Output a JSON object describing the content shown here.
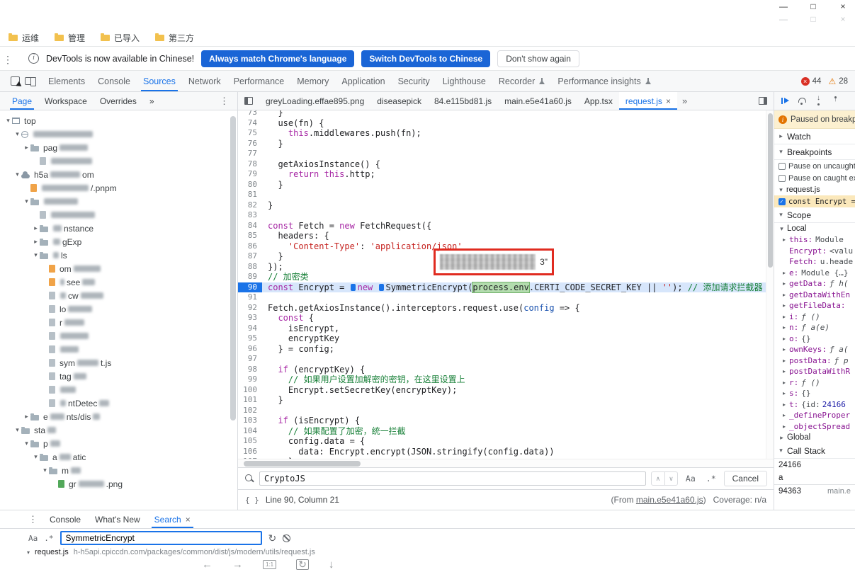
{
  "title_bar": {
    "controls": [
      "minimize",
      "maximize",
      "close"
    ]
  },
  "bookmarks": {
    "items": [
      "运维",
      "管理",
      "已导入",
      "第三方"
    ]
  },
  "banner": {
    "message": "DevTools is now available in Chinese!",
    "primary_buttons": [
      "Always match Chrome's language",
      "Switch DevTools to Chinese"
    ],
    "secondary_button": "Don't show again"
  },
  "toolbar": {
    "tabs": [
      "Elements",
      "Console",
      "Sources",
      "Network",
      "Performance",
      "Memory",
      "Application",
      "Security",
      "Lighthouse",
      "Recorder",
      "Performance insights"
    ],
    "selected_tab": "Sources",
    "flask_tabs": [
      "Recorder",
      "Performance insights"
    ],
    "error_count": "44",
    "warning_count": "28"
  },
  "navigator": {
    "tabs": [
      "Page",
      "Workspace",
      "Overrides",
      "»"
    ],
    "selected_tab": "Page",
    "tree": [
      {
        "lvl": 0,
        "arrow": "open",
        "icon": "frame",
        "parts": [
          {
            "t": "top"
          }
        ]
      },
      {
        "lvl": 1,
        "arrow": "open",
        "icon": "globe",
        "parts": [
          {
            "b": 84
          }
        ]
      },
      {
        "lvl": 2,
        "arrow": "closed",
        "icon": "folder",
        "parts": [
          {
            "t": "pag"
          },
          {
            "b": 40
          }
        ]
      },
      {
        "lvl": 3,
        "arrow": "none",
        "icon": "doc",
        "parts": [
          {
            "b": 58
          }
        ]
      },
      {
        "lvl": 1,
        "arrow": "open",
        "icon": "cloud",
        "parts": [
          {
            "t": "h5a"
          },
          {
            "b": 42
          },
          {
            "t": "om"
          }
        ]
      },
      {
        "lvl": 2,
        "arrow": "none",
        "icon": "doc-o",
        "parts": [
          {
            "b": 66
          },
          {
            "t": "/.pnpm"
          }
        ]
      },
      {
        "lvl": 2,
        "arrow": "open",
        "icon": "folder",
        "parts": [
          {
            "b": 48
          }
        ]
      },
      {
        "lvl": 3,
        "arrow": "none",
        "icon": "doc",
        "parts": [
          {
            "b": 62
          }
        ]
      },
      {
        "lvl": 3,
        "arrow": "closed",
        "icon": "folder",
        "parts": [
          {
            "b": 12
          },
          {
            "t": "nstance"
          }
        ]
      },
      {
        "lvl": 3,
        "arrow": "closed",
        "icon": "folder",
        "parts": [
          {
            "b": 10
          },
          {
            "t": "gExp"
          }
        ]
      },
      {
        "lvl": 3,
        "arrow": "open",
        "icon": "folder",
        "parts": [
          {
            "b": 8
          },
          {
            "t": "ls"
          }
        ]
      },
      {
        "lvl": 4,
        "arrow": "none",
        "icon": "doc-o",
        "parts": [
          {
            "t": "om"
          },
          {
            "b": 38
          }
        ]
      },
      {
        "lvl": 4,
        "arrow": "none",
        "icon": "doc-o",
        "parts": [
          {
            "b": 6
          },
          {
            "t": "see"
          },
          {
            "b": 18
          }
        ]
      },
      {
        "lvl": 4,
        "arrow": "none",
        "icon": "doc",
        "parts": [
          {
            "b": 8
          },
          {
            "t": "cw"
          },
          {
            "b": 32
          }
        ]
      },
      {
        "lvl": 4,
        "arrow": "none",
        "icon": "doc",
        "parts": [
          {
            "t": "lo"
          },
          {
            "b": 34
          }
        ]
      },
      {
        "lvl": 4,
        "arrow": "none",
        "icon": "doc",
        "parts": [
          {
            "t": "r"
          },
          {
            "b": 28
          }
        ]
      },
      {
        "lvl": 4,
        "arrow": "none",
        "icon": "doc",
        "parts": [
          {
            "b": 40
          }
        ]
      },
      {
        "lvl": 4,
        "arrow": "none",
        "icon": "doc",
        "parts": [
          {
            "b": 26
          }
        ]
      },
      {
        "lvl": 4,
        "arrow": "none",
        "icon": "doc",
        "parts": [
          {
            "t": "sym"
          },
          {
            "b": 30
          },
          {
            "t": "t.js"
          }
        ]
      },
      {
        "lvl": 4,
        "arrow": "none",
        "icon": "doc",
        "parts": [
          {
            "t": "tag"
          },
          {
            "b": 18
          }
        ]
      },
      {
        "lvl": 4,
        "arrow": "none",
        "icon": "doc",
        "parts": [
          {
            "b": 22
          }
        ]
      },
      {
        "lvl": 4,
        "arrow": "none",
        "icon": "doc",
        "parts": [
          {
            "b": 8
          },
          {
            "t": "ntDetec"
          },
          {
            "b": 14
          }
        ]
      },
      {
        "lvl": 2,
        "arrow": "closed",
        "icon": "folder",
        "parts": [
          {
            "t": "e"
          },
          {
            "b": 20
          },
          {
            "t": "nts/dis"
          },
          {
            "b": 10
          }
        ]
      },
      {
        "lvl": 1,
        "arrow": "open",
        "icon": "folder",
        "parts": [
          {
            "t": "sta"
          },
          {
            "b": 12
          }
        ]
      },
      {
        "lvl": 2,
        "arrow": "open",
        "icon": "folder",
        "parts": [
          {
            "t": "p"
          },
          {
            "b": 14
          }
        ]
      },
      {
        "lvl": 3,
        "arrow": "open",
        "icon": "folder",
        "parts": [
          {
            "t": "a"
          },
          {
            "b": 16
          },
          {
            "t": "atic"
          }
        ]
      },
      {
        "lvl": 4,
        "arrow": "open",
        "icon": "folder",
        "parts": [
          {
            "t": "m"
          },
          {
            "b": 14
          }
        ]
      },
      {
        "lvl": 5,
        "arrow": "none",
        "icon": "img",
        "parts": [
          {
            "t": "gr"
          },
          {
            "b": 36
          },
          {
            "t": ".png"
          }
        ]
      }
    ]
  },
  "editor": {
    "file_tabs": [
      "greyLoading.effae895.png",
      "diseasepick",
      "84.e115bd81.js",
      "main.e5e41a60.js",
      "App.tsx",
      "request.js"
    ],
    "active_tab": "request.js",
    "overflow": "»",
    "annotation_text": "3\"",
    "code": {
      "current_line": 90,
      "lines": [
        {
          "n": 73,
          "t": [
            [
              "p",
              "  }"
            ]
          ]
        },
        {
          "n": 74,
          "t": [
            [
              "p",
              "  use(fn) {"
            ]
          ]
        },
        {
          "n": 75,
          "t": [
            [
              "p",
              "    "
            ],
            [
              "k",
              "this"
            ],
            [
              "p",
              ".middlewares.push(fn);"
            ]
          ]
        },
        {
          "n": 76,
          "t": [
            [
              "p",
              "  }"
            ]
          ]
        },
        {
          "n": 77,
          "t": []
        },
        {
          "n": 78,
          "t": [
            [
              "p",
              "  getAxiosInstance() {"
            ]
          ]
        },
        {
          "n": 79,
          "t": [
            [
              "p",
              "    "
            ],
            [
              "k",
              "return"
            ],
            [
              "p",
              " "
            ],
            [
              "k",
              "this"
            ],
            [
              "p",
              ".http;"
            ]
          ]
        },
        {
          "n": 80,
          "t": [
            [
              "p",
              "  }"
            ]
          ]
        },
        {
          "n": 81,
          "t": []
        },
        {
          "n": 82,
          "t": [
            [
              "p",
              "}"
            ]
          ]
        },
        {
          "n": 83,
          "t": []
        },
        {
          "n": 84,
          "t": [
            [
              "k",
              "const"
            ],
            [
              "p",
              " Fetch = "
            ],
            [
              "k",
              "new"
            ],
            [
              "p",
              " FetchRequest({"
            ]
          ]
        },
        {
          "n": 85,
          "t": [
            [
              "p",
              "  headers: {"
            ]
          ]
        },
        {
          "n": 86,
          "t": [
            [
              "p",
              "    "
            ],
            [
              "s",
              "'Content-Type'"
            ],
            [
              "p",
              ": "
            ],
            [
              "s",
              "'application/json'"
            ]
          ]
        },
        {
          "n": 87,
          "t": [
            [
              "p",
              "  }"
            ]
          ]
        },
        {
          "n": 88,
          "t": [
            [
              "p",
              "});"
            ]
          ]
        },
        {
          "n": 89,
          "t": [
            [
              "c",
              "// 加密类"
            ]
          ]
        },
        {
          "n": 90,
          "t": [
            [
              "k",
              "const"
            ],
            [
              "p",
              " Encrypt = "
            ],
            [
              "b",
              ""
            ],
            [
              "k",
              "new"
            ],
            [
              "p",
              " "
            ],
            [
              "b",
              ""
            ],
            [
              "p",
              "SymmetricEncrypt("
            ],
            [
              "g",
              "process.env"
            ],
            [
              "p",
              ".CERTI_CODE_SECRET_KEY || "
            ],
            [
              "s",
              "''"
            ],
            [
              "p",
              "); "
            ],
            [
              "c",
              "// 添加请求拦截器"
            ]
          ]
        },
        {
          "n": 91,
          "t": []
        },
        {
          "n": 92,
          "t": [
            [
              "p",
              "Fetch.getAxiosInstance().interceptors.request.use("
            ],
            [
              "d",
              "config"
            ],
            [
              "p",
              " => {"
            ]
          ]
        },
        {
          "n": 93,
          "t": [
            [
              "p",
              "  "
            ],
            [
              "k",
              "const"
            ],
            [
              "p",
              " {"
            ]
          ]
        },
        {
          "n": 94,
          "t": [
            [
              "p",
              "    isEncrypt,"
            ]
          ]
        },
        {
          "n": 95,
          "t": [
            [
              "p",
              "    encryptKey"
            ]
          ]
        },
        {
          "n": 96,
          "t": [
            [
              "p",
              "  } = config;"
            ]
          ]
        },
        {
          "n": 97,
          "t": []
        },
        {
          "n": 98,
          "t": [
            [
              "p",
              "  "
            ],
            [
              "k",
              "if"
            ],
            [
              "p",
              " (encryptKey) {"
            ]
          ]
        },
        {
          "n": 99,
          "t": [
            [
              "p",
              "    "
            ],
            [
              "c",
              "// 如果用户设置加解密的密钥，在这里设置上"
            ]
          ]
        },
        {
          "n": 100,
          "t": [
            [
              "p",
              "    Encrypt.setSecretKey(encryptKey);"
            ]
          ]
        },
        {
          "n": 101,
          "t": [
            [
              "p",
              "  }"
            ]
          ]
        },
        {
          "n": 102,
          "t": []
        },
        {
          "n": 103,
          "t": [
            [
              "p",
              "  "
            ],
            [
              "k",
              "if"
            ],
            [
              "p",
              " (isEncrypt) {"
            ]
          ]
        },
        {
          "n": 104,
          "t": [
            [
              "p",
              "    "
            ],
            [
              "c",
              "// 如果配置了加密，统一拦截"
            ]
          ]
        },
        {
          "n": 105,
          "t": [
            [
              "p",
              "    config.data = {"
            ]
          ]
        },
        {
          "n": 106,
          "t": [
            [
              "p",
              "      data: Encrypt.encrypt(JSON.stringify(config.data))"
            ]
          ]
        },
        {
          "n": 107,
          "t": [
            [
              "p",
              "    };"
            ]
          ]
        }
      ]
    },
    "find_bar": {
      "query": "CryptoJS",
      "case_toggle": "Aa",
      "regex_toggle": ".*",
      "cancel": "Cancel"
    },
    "status_bar": {
      "position": "Line 90, Column 21",
      "from_prefix": "(From ",
      "from_link": "main.e5e41a60.js",
      "from_suffix": ")",
      "coverage": "Coverage: n/a"
    }
  },
  "debugger": {
    "toolbar_icons": [
      "resume",
      "step-over",
      "step-into",
      "step-out"
    ],
    "paused_text": "Paused on breakpoint",
    "watch": {
      "label": "Watch"
    },
    "breakpoints": {
      "label": "Breakpoints",
      "pause_uncaught": "Pause on uncaught exceptions",
      "pause_caught": "Pause on caught exceptions",
      "file": "request.js",
      "entry": "const Encrypt = new SymmetricEncr"
    },
    "scope": {
      "label": "Scope",
      "local_label": "Local",
      "global_label": "Global",
      "entries": [
        {
          "a": 1,
          "n": "this:",
          "v": "Module"
        },
        {
          "a": 0,
          "n": "Encrypt:",
          "v": "<valu"
        },
        {
          "a": 0,
          "n": "Fetch:",
          "v": "u.heade"
        },
        {
          "a": 1,
          "n": "e:",
          "v": "Module {…}"
        },
        {
          "a": 1,
          "n": "getData:",
          "v": "ƒ h(",
          "f": 1
        },
        {
          "a": 1,
          "n": "getDataWithEn",
          "v": ""
        },
        {
          "a": 1,
          "n": "getFileData:",
          "v": ""
        },
        {
          "a": 1,
          "n": "i:",
          "v": "ƒ ()",
          "f": 1
        },
        {
          "a": 1,
          "n": "n:",
          "v": "ƒ a(e)",
          "f": 1
        },
        {
          "a": 1,
          "n": "o:",
          "v": "{}"
        },
        {
          "a": 1,
          "n": "ownKeys:",
          "v": "ƒ a(",
          "f": 1
        },
        {
          "a": 1,
          "n": "postData:",
          "v": "ƒ p",
          "f": 1
        },
        {
          "a": 1,
          "n": "postDataWithR",
          "v": ""
        },
        {
          "a": 1,
          "n": "r:",
          "v": "ƒ ()",
          "f": 1
        },
        {
          "a": 1,
          "n": "s:",
          "v": "{}"
        },
        {
          "a": 1,
          "n": "t:",
          "v": "{id:",
          "num": "24166"
        },
        {
          "a": 1,
          "n": "_defineProper",
          "v": ""
        },
        {
          "a": 1,
          "n": "_objectSpread",
          "v": ""
        }
      ]
    },
    "call_stack": {
      "label": "Call Stack",
      "frames": [
        {
          "name": "24166",
          "loc": ""
        },
        {
          "name": "a",
          "loc": ""
        },
        {
          "name": "94363",
          "loc": "main.e",
          "divider": true
        }
      ]
    }
  },
  "drawer": {
    "tabs": [
      "Console",
      "What's New",
      "Search"
    ],
    "active_tab": "Search",
    "search": {
      "case_toggle": "Aa",
      "regex_toggle": ".*",
      "query": "SymmetricEncrypt"
    },
    "result": {
      "file": "request.js",
      "path": "h-h5api.cpiccdn.com/packages/common/dist/js/modern/utils/request.js"
    }
  },
  "page_footer": {
    "icons": [
      "back",
      "forward",
      "one-to-one",
      "rotate",
      "download"
    ]
  }
}
